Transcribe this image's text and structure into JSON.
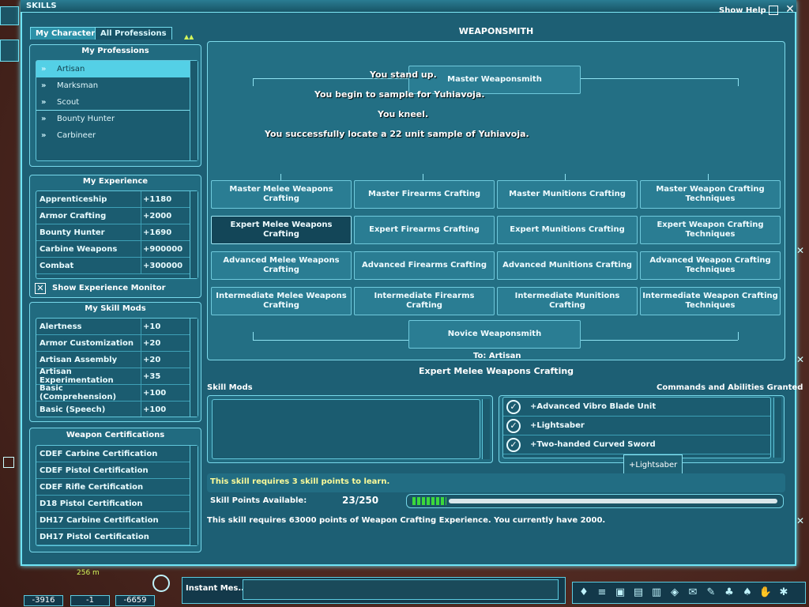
{
  "window": {
    "title": "SKILLS",
    "show_help": "Show Help"
  },
  "tabs": [
    "My Character",
    "All Professions"
  ],
  "professions": {
    "title": "My Professions",
    "items": [
      "Artisan",
      "Marksman",
      "Scout",
      "Bounty Hunter",
      "Carbineer"
    ]
  },
  "experience": {
    "title": "My Experience",
    "rows": [
      [
        "Apprenticeship",
        "+1180"
      ],
      [
        "Armor Crafting",
        "+2000"
      ],
      [
        "Bounty Hunter",
        "+1690"
      ],
      [
        "Carbine Weapons",
        "+900000"
      ],
      [
        "Combat",
        "+300000"
      ]
    ],
    "monitor_label": "Show Experience Monitor"
  },
  "skill_mods": {
    "title": "My Skill Mods",
    "rows": [
      [
        "Alertness",
        "+10"
      ],
      [
        "Armor Customization",
        "+20"
      ],
      [
        "Artisan Assembly",
        "+20"
      ],
      [
        "Artisan Experimentation",
        "+35"
      ],
      [
        "Basic (Comprehension)",
        "+100"
      ],
      [
        "Basic (Speech)",
        "+100"
      ]
    ]
  },
  "certs": {
    "title": "Weapon Certifications",
    "items": [
      "CDEF Carbine Certification",
      "CDEF Pistol Certification",
      "CDEF Rifle Certification",
      "D18 Pistol Certification",
      "DH17 Carbine Certification",
      "DH17 Pistol Certification"
    ]
  },
  "tree": {
    "title": "WEAPONSMITH",
    "master": "Master Weaponsmith",
    "novice": "Novice Weaponsmith",
    "to": "To: Artisan",
    "messages": [
      "You stand up.",
      "You begin to sample for Yuhiavoja.",
      "You kneel.",
      "You successfully locate a 22 unit sample of Yuhiavoja."
    ],
    "rows": [
      [
        "Master Melee Weapons Crafting",
        "Master Firearms Crafting",
        "Master Munitions Crafting",
        "Master Weapon Crafting Techniques"
      ],
      [
        "Expert Melee Weapons Crafting",
        "Expert Firearms Crafting",
        "Expert Munitions Crafting",
        "Expert Weapon Crafting Techniques"
      ],
      [
        "Advanced Melee Weapons Crafting",
        "Advanced Firearms Crafting",
        "Advanced Munitions Crafting",
        "Advanced Weapon Crafting Techniques"
      ],
      [
        "Intermediate Melee Weapons Crafting",
        "Intermediate Firearms Crafting",
        "Intermediate Munitions Crafting",
        "Intermediate Weapon Crafting Techniques"
      ]
    ]
  },
  "detail": {
    "selected": "Expert Melee Weapons Crafting",
    "skill_mods_label": "Skill Mods",
    "commands_label": "Commands and Abilities Granted",
    "commands": [
      "+Advanced Vibro Blade Unit",
      "+Lightsaber",
      "+Two-handed Curved Sword"
    ],
    "tooltip": "+Lightsaber",
    "requires_points": "This skill requires 3 skill points to learn.",
    "points_label": "Skill Points Available:",
    "points_value": "23/250",
    "points_fraction": 0.092,
    "requires_xp": "This skill requires 63000 points of Weapon Crafting Experience.  You currently have 2000."
  },
  "hud": {
    "distance": "256 m",
    "coords": [
      "-3916",
      "-1",
      "-6659"
    ],
    "chat_placeholder": "Instant Mes..."
  }
}
